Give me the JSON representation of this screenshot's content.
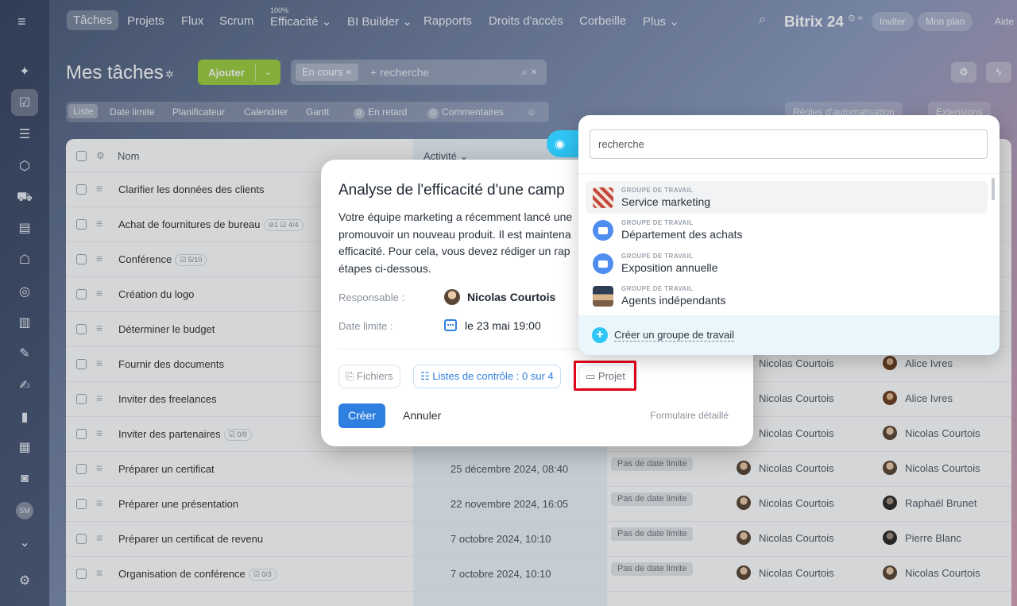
{
  "nav": {
    "items": [
      {
        "label": "Tâches"
      },
      {
        "label": "Projets"
      },
      {
        "label": "Flux"
      },
      {
        "label": "Scrum"
      },
      {
        "label": "Efficacité ⌄",
        "sup": "100%"
      },
      {
        "label": "BI Builder ⌄"
      },
      {
        "label": "Rapports"
      },
      {
        "label": "Droits d'accès"
      },
      {
        "label": "Corbeille"
      },
      {
        "label": "Plus ⌄"
      }
    ],
    "logo": "Bitrix 24",
    "logo_suffix": "⊙ ≈",
    "invite": "Inviter",
    "plan": "Mon plan",
    "help": "Aide"
  },
  "sidebar_icons": [
    "burger-icon",
    "widget-icon",
    "tasks-icon",
    "feed-icon",
    "box-icon",
    "cart-icon",
    "contact-icon",
    "robot-icon",
    "target-icon",
    "building-icon",
    "pen-icon",
    "sign-icon",
    "chart-icon",
    "calendar-icon",
    "support-icon",
    "avatar-sm",
    "chevron-down-icon",
    "settings-icon"
  ],
  "user_initials": "SM",
  "header": {
    "title": "Mes tâches",
    "add_button": "Ajouter",
    "filter_chip": "En cours",
    "search_placeholder": "+ recherche"
  },
  "views": {
    "items": [
      "Liste",
      "Date limite",
      "Planificateur",
      "Calendrier",
      "Gantt"
    ],
    "overdue_count": "0",
    "overdue_label": "En retard",
    "comments_count": "0",
    "comments_label": "Commentaires",
    "automation": "Règles d'automatisation",
    "extensions": "Extensions"
  },
  "grid": {
    "col_name": "Nom",
    "col_activity": "Activité ⌄",
    "rows": [
      {
        "name": "Clarifier les données des clients",
        "badge": "",
        "date": "",
        "deadline": "",
        "p1": "",
        "p2": ""
      },
      {
        "name": "Achat de fournitures de bureau",
        "badge": "⊘1  ☑ 4/4",
        "date": "",
        "deadline": "",
        "p1": "",
        "p2": ""
      },
      {
        "name": "Conférence",
        "badge": "☑ 5/10",
        "date": "",
        "deadline": "",
        "p1": "",
        "p2": ""
      },
      {
        "name": "Création du logo",
        "badge": "",
        "date": "",
        "deadline": "",
        "p1": "",
        "p2": ""
      },
      {
        "name": "Déterminer le budget",
        "badge": "",
        "date": "",
        "deadline": "",
        "p1": "",
        "p2": ""
      },
      {
        "name": "Fournir des documents",
        "badge": "",
        "date": "",
        "deadline": "",
        "p1": "Nicolas Courtois",
        "p2": "Alice Ivres"
      },
      {
        "name": "Inviter des freelances",
        "badge": "",
        "date": "",
        "deadline": "",
        "p1": "Nicolas Courtois",
        "p2": "Alice Ivres"
      },
      {
        "name": "Inviter des partenaires",
        "badge": "☑ 0/9",
        "date": "",
        "deadline": "",
        "p1": "Nicolas Courtois",
        "p2": "Nicolas Courtois"
      },
      {
        "name": "Préparer un certificat",
        "badge": "",
        "date": "25 décembre 2024, 08:40",
        "deadline": "Pas de date limite",
        "p1": "Nicolas Courtois",
        "p2": "Nicolas Courtois"
      },
      {
        "name": "Préparer une présentation",
        "badge": "",
        "date": "22 novembre 2024, 16:05",
        "deadline": "Pas de date limite",
        "p1": "Nicolas Courtois",
        "p2": "Raphaël Brunet"
      },
      {
        "name": "Préparer un certificat de revenu",
        "badge": "",
        "date": "7 octobre 2024, 10:10",
        "deadline": "Pas de date limite",
        "p1": "Nicolas Courtois",
        "p2": "Pierre Blanc"
      },
      {
        "name": "Organisation de conférence",
        "badge": "☑ 0/3",
        "date": "7 octobre 2024, 10:10",
        "deadline": "Pas de date limite",
        "p1": "Nicolas Courtois",
        "p2": "Nicolas Courtois"
      }
    ]
  },
  "modal": {
    "title": "Analyse de l'efficacité d'une camp",
    "description": "Votre équipe marketing a récemment lancé une promouvoir un nouveau produit. Il est maintena efficacité. Pour cela, vous devez rédiger un rap étapes ci-dessous.",
    "responsible_label": "Responsable :",
    "responsible": "Nicolas Courtois",
    "deadline_label": "Date limite :",
    "deadline": "le 23 mai 19:00",
    "files_button": "⎘ Fichiers",
    "checklist_button": "☷ Listes de contrôle : 0 sur 4",
    "project_button": "▭ Projet",
    "create_button": "Créer",
    "cancel_button": "Annuler",
    "detailed_form": "Formulaire détaillé"
  },
  "dropdown": {
    "search_placeholder": "recherche",
    "items": [
      {
        "type": "GROUPE DE TRAVAIL",
        "name": "Service marketing"
      },
      {
        "type": "GROUPE DE TRAVAIL",
        "name": "Département des achats"
      },
      {
        "type": "GROUPE DE TRAVAIL",
        "name": "Exposition annuelle"
      },
      {
        "type": "GROUPE DE TRAVAIL",
        "name": "Agents indépendants"
      }
    ],
    "create_group": "Créer un groupe de travail"
  }
}
